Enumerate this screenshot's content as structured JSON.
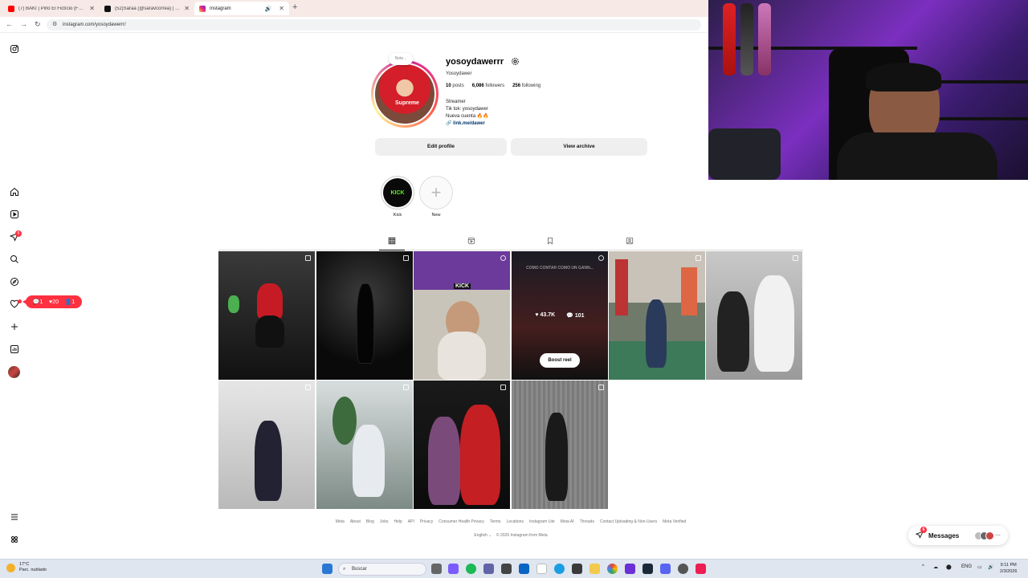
{
  "browser": {
    "tabs": [
      {
        "label": "(7) BAKI | Pirlo El Fictício (Fuerza..."
      },
      {
        "label": "(52)Saraa (@saravcorrea) | TikTok"
      },
      {
        "label": "Instagram"
      }
    ],
    "url": "instagram.com/yosoydawerrr/"
  },
  "profile": {
    "note": "Note...",
    "username": "yosoydawerrr",
    "full_name": "Yosoydawer",
    "stats": {
      "posts_count": "10",
      "posts_label": "posts",
      "followers_count": "6,086",
      "followers_label": "followers",
      "following_count": "256",
      "following_label": "following"
    },
    "bio": [
      "Streamer",
      "Tik tok: yosoydawer",
      "Nueva cuenta 🔥🔥"
    ],
    "link": "link.me/dawer",
    "avatar_text": "Supreme",
    "edit_label": "Edit profile",
    "archive_label": "View archive"
  },
  "highlights": [
    {
      "label": "Kick",
      "cover": "KICK"
    },
    {
      "label": "New"
    }
  ],
  "notifications": {
    "comments": "1",
    "likes": "20",
    "follows": "1"
  },
  "nav_badge": "6",
  "grid": {
    "hover": {
      "likes": "43.7K",
      "comments": "101",
      "boost_label": "Boost reel"
    },
    "reel_caption": "COMO CONTAR COMO UN GANN...",
    "kick_overlay": "KICK"
  },
  "footer": {
    "links": [
      "Meta",
      "About",
      "Blog",
      "Jobs",
      "Help",
      "API",
      "Privacy",
      "Consumer Health Privacy",
      "Terms",
      "Locations",
      "Instagram Lite",
      "Meta AI",
      "Threads",
      "Contact Uploading & Non-Users",
      "Meta Verified"
    ],
    "language": "English",
    "copyright": "© 2026 Instagram from Meta"
  },
  "messages": {
    "label": "Messages",
    "badge": "6"
  },
  "taskbar": {
    "temp": "17°C",
    "weather": "Parc. nublado",
    "search_placeholder": "Buscar",
    "lang": "ENG",
    "time": "9:11 PM",
    "date": "2/3/2026"
  },
  "colors": {
    "accent_red": "#ff3040",
    "kick_green": "#53fc18",
    "link_blue": "#00376b"
  }
}
